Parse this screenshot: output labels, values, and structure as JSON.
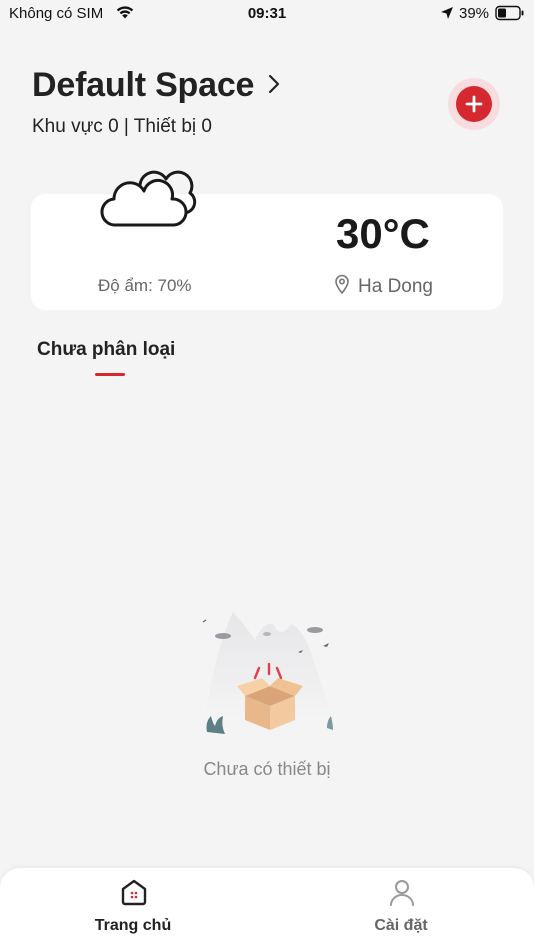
{
  "status_bar": {
    "carrier": "Không có SIM",
    "time": "09:31",
    "battery": "39%"
  },
  "header": {
    "title": "Default Space",
    "summary": "Khu vực 0 | Thiết bị 0"
  },
  "weather": {
    "humidity": "Độ ẩm: 70%",
    "temperature": "30°C",
    "location": "Ha Dong"
  },
  "tabs": [
    {
      "label": "Chưa phân loại"
    }
  ],
  "empty_state": {
    "message": "Chưa có thiết bị"
  },
  "bottom_nav": [
    {
      "label": "Trang chủ"
    },
    {
      "label": "Cài đặt"
    }
  ],
  "colors": {
    "accent": "#d6282f",
    "background": "#f4f4f5",
    "card": "#ffffff"
  },
  "icons": [
    "wifi-icon",
    "location-arrow-icon",
    "battery-icon",
    "chevron-right-icon",
    "plus-icon",
    "cloud-icon",
    "location-pin-icon",
    "empty-box-icon",
    "home-icon",
    "person-icon"
  ]
}
